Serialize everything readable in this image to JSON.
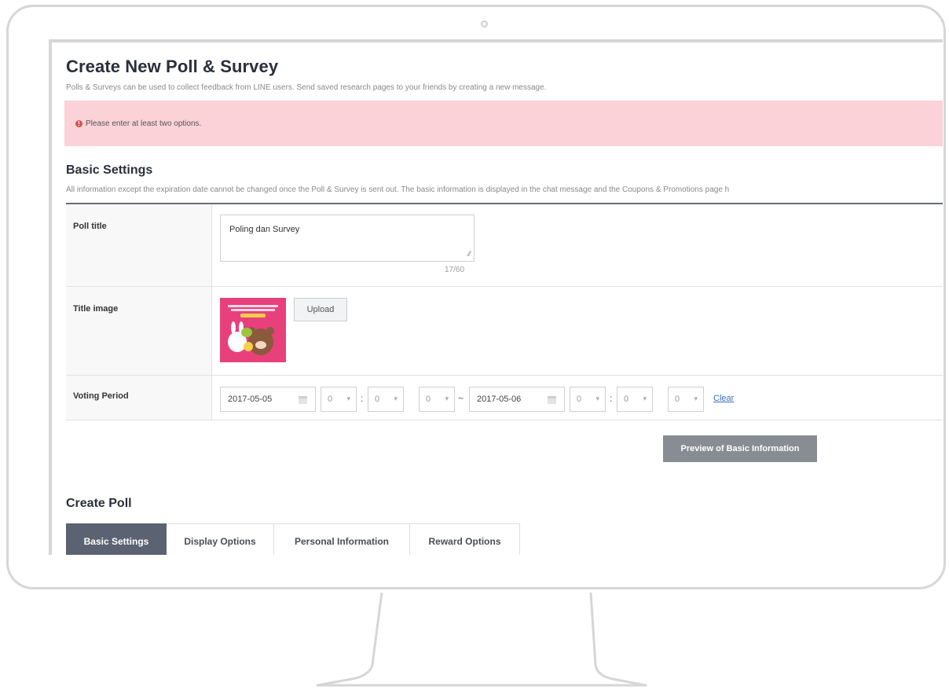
{
  "page": {
    "title": "Create New Poll & Survey",
    "description": "Polls & Surveys can be used to collect feedback from LINE users. Send saved research pages to your friends by creating a new message."
  },
  "alert": {
    "icon": "exclamation-circle-icon",
    "message": "Please enter at least two options.",
    "color": "#fad2d7"
  },
  "basic_settings": {
    "title": "Basic Settings",
    "description": "All information except the expiration date cannot be changed once the Poll & Survey is sent out. The basic information is displayed in the chat message and the Coupons & Promotions page h",
    "poll_title": {
      "label": "Poll title",
      "value": "Poling dan Survey",
      "char_count": "17/60"
    },
    "title_image": {
      "label": "Title image",
      "upload_label": "Upload"
    },
    "voting_period": {
      "label": "Voting Period",
      "start_date": "2017-05-05",
      "start_hour": "0",
      "start_minute": "0",
      "start_second": "0",
      "range_separator": "~",
      "end_date": "2017-05-06",
      "end_hour": "0",
      "end_minute": "0",
      "end_second": "0",
      "time_separator": ":",
      "clear_label": "Clear"
    },
    "preview_button": "Preview of Basic Information"
  },
  "create_poll": {
    "title": "Create Poll",
    "tabs": [
      {
        "label": "Basic Settings",
        "active": true
      },
      {
        "label": "Display Options",
        "active": false
      },
      {
        "label": "Personal Information",
        "active": false
      },
      {
        "label": "Reward Options",
        "active": false
      }
    ]
  },
  "colors": {
    "active_tab": "#5b6272",
    "preview_button": "#888c93",
    "link": "#3a6fc4",
    "title_image_bg": "#e8407a"
  }
}
